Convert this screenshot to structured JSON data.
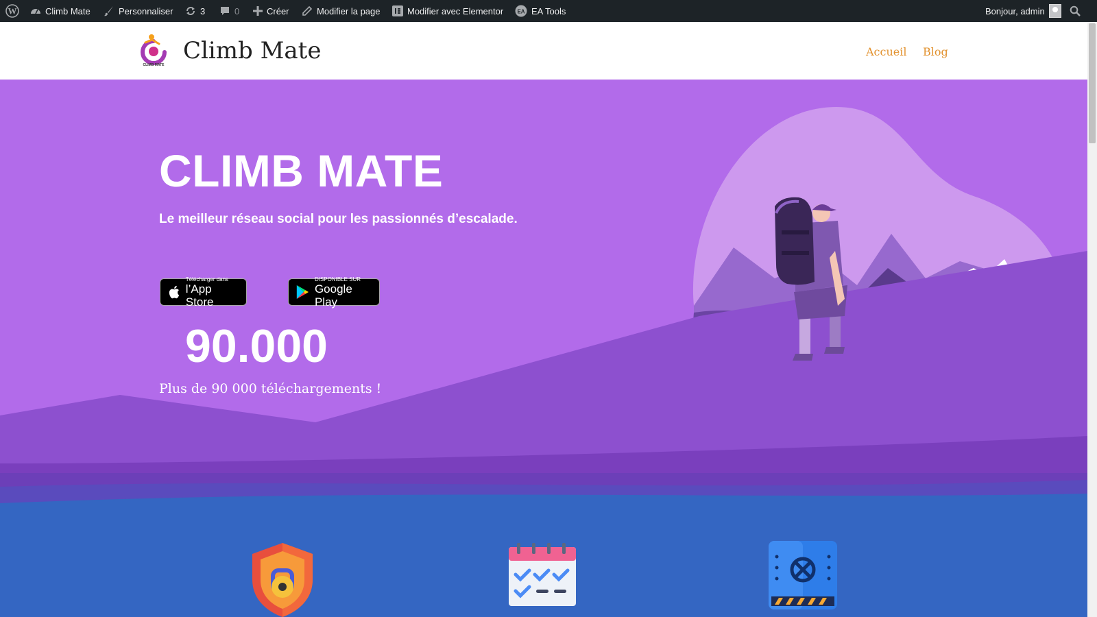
{
  "admin_bar": {
    "site_name": "Climb Mate",
    "customize": "Personnaliser",
    "updates_count": "3",
    "comments_count": "0",
    "new": "Créer",
    "edit_page": "Modifier la page",
    "elementor": "Modifier avec Elementor",
    "ea_tools": "EA Tools",
    "greeting": "Bonjour, admin"
  },
  "header": {
    "logo_caption": "CLIMB MATE",
    "title": "Climb Mate",
    "nav": [
      "Accueil",
      "Blog"
    ]
  },
  "hero": {
    "title": "CLIMB MATE",
    "subtitle": "Le meilleur réseau social pour les passionnés d’escalade.",
    "app_store": {
      "small": "Télécharger dans",
      "big": "l’App Store"
    },
    "google_play": {
      "small": "DISPONIBLE SUR",
      "big": "Google Play"
    },
    "counter": "90.000",
    "counter_caption": "Plus de 90 000 téléchargements !"
  },
  "features": {
    "icons": [
      "security-shield-icon",
      "calendar-checklist-icon",
      "control-panel-icon"
    ]
  },
  "colors": {
    "admin_bar": "#1d2327",
    "accent": "#e2912d",
    "hero_bg": "#b26bea",
    "features_bg": "#3466c2"
  }
}
